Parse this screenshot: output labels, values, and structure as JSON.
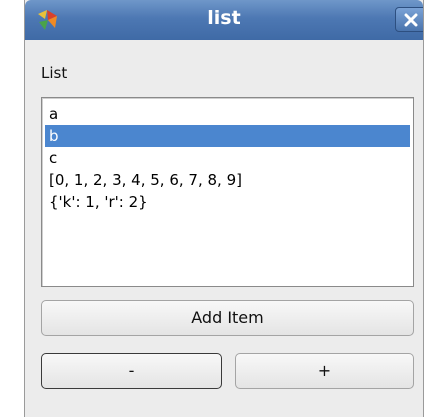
{
  "window": {
    "title": "list"
  },
  "list": {
    "label": "List",
    "items": [
      {
        "text": "a",
        "selected": false
      },
      {
        "text": "b",
        "selected": true
      },
      {
        "text": "c",
        "selected": false
      },
      {
        "text": "[0, 1, 2, 3, 4, 5, 6, 7, 8, 9]",
        "selected": false
      },
      {
        "text": "{'k': 1, 'r': 2}",
        "selected": false
      }
    ]
  },
  "buttons": {
    "add_label": "Add Item",
    "minus_label": "-",
    "plus_label": "+"
  },
  "colors": {
    "titlebar": "#4d78b3",
    "selection": "#4b86cf",
    "window_bg": "#ececec"
  },
  "icons": {
    "app": "app-logo-icon",
    "close": "close-icon"
  }
}
